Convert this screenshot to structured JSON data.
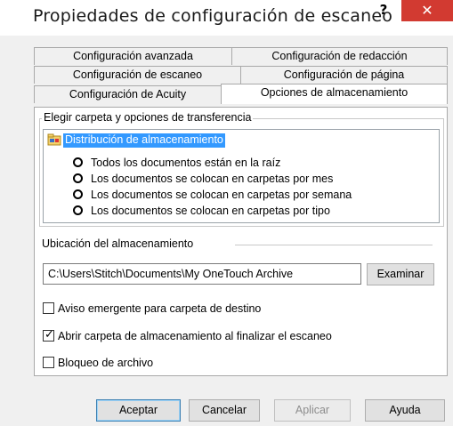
{
  "window": {
    "title": "Propiedades de configuración de escaneo",
    "help_glyph": "?",
    "close_glyph": "✕"
  },
  "tabs": {
    "row1": [
      "Configuración avanzada",
      "Configuración de redacción"
    ],
    "row2": [
      "Configuración de escaneo",
      "Configuración de página"
    ],
    "row3": [
      "Configuración de Acuity",
      "Opciones de almacenamiento"
    ],
    "active": "Opciones de almacenamiento"
  },
  "folder_group": {
    "label": "Elegir carpeta y opciones de transferencia",
    "root_label": "Distribución de almacenamiento",
    "options": [
      "Todos los documentos están en la raíz",
      "Los documentos se colocan en carpetas por mes",
      "Los documentos se colocan en carpetas por semana",
      "Los documentos se colocan en carpetas por tipo"
    ]
  },
  "storage": {
    "label": "Ubicación del almacenamiento",
    "path": "C:\\Users\\Stitch\\Documents\\My OneTouch Archive",
    "browse_label": "Examinar"
  },
  "checkboxes": [
    {
      "label": "Aviso emergente para carpeta de destino",
      "checked": false
    },
    {
      "label": "Abrir carpeta de almacenamiento al finalizar el escaneo",
      "checked": true
    },
    {
      "label": "Bloqueo de archivo",
      "checked": false
    }
  ],
  "buttons": {
    "ok": "Aceptar",
    "cancel": "Cancelar",
    "apply": "Aplicar",
    "help": "Ayuda"
  },
  "colors": {
    "close": "#d23a31",
    "selection": "#3399ff"
  },
  "icons": [
    "folder-tree-icon",
    "help-icon",
    "close-icon",
    "checkmark-icon"
  ]
}
